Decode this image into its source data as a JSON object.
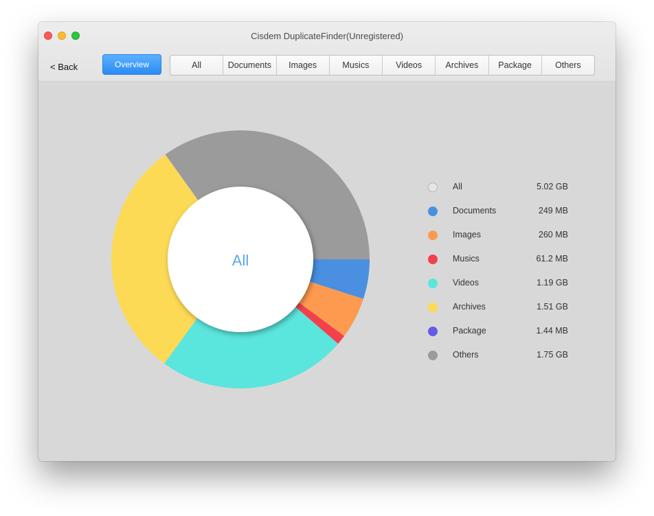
{
  "window": {
    "title": "Cisdem DuplicateFinder(Unregistered)"
  },
  "toolbar": {
    "back_label": "< Back",
    "overview_label": "Overview",
    "tabs": [
      {
        "label": "All"
      },
      {
        "label": "Documents"
      },
      {
        "label": "Images"
      },
      {
        "label": "Musics"
      },
      {
        "label": "Videos"
      },
      {
        "label": "Archives"
      },
      {
        "label": "Package"
      },
      {
        "label": "Others"
      }
    ]
  },
  "colors": {
    "accent": "#2b8bf5",
    "center_text": "#5ba7ea"
  },
  "chart_data": {
    "type": "pie",
    "center_label": "All",
    "unit": "GB",
    "slices": [
      {
        "name": "Documents",
        "value": 0.249,
        "color": "#4a8fe0"
      },
      {
        "name": "Images",
        "value": 0.26,
        "color": "#fd9a4f"
      },
      {
        "name": "Musics",
        "value": 0.0612,
        "color": "#f3404c"
      },
      {
        "name": "Videos",
        "value": 1.19,
        "color": "#5ae5dd"
      },
      {
        "name": "Archives",
        "value": 1.51,
        "color": "#fdda55"
      },
      {
        "name": "Package",
        "value": 0.00144,
        "color": "#6559e8"
      },
      {
        "name": "Others",
        "value": 1.75,
        "color": "#9b9b9b"
      }
    ]
  },
  "legend": [
    {
      "label": "All",
      "value": "5.02 GB",
      "color": "#e0e0e0",
      "outline": true
    },
    {
      "label": "Documents",
      "value": "249 MB",
      "color": "#4a8fe0"
    },
    {
      "label": "Images",
      "value": "260 MB",
      "color": "#fd9a4f"
    },
    {
      "label": "Musics",
      "value": "61.2 MB",
      "color": "#f3404c"
    },
    {
      "label": "Videos",
      "value": "1.19 GB",
      "color": "#5ae5dd"
    },
    {
      "label": "Archives",
      "value": "1.51 GB",
      "color": "#fdda55"
    },
    {
      "label": "Package",
      "value": "1.44 MB",
      "color": "#6559e8"
    },
    {
      "label": "Others",
      "value": "1.75 GB",
      "color": "#9b9b9b"
    }
  ]
}
